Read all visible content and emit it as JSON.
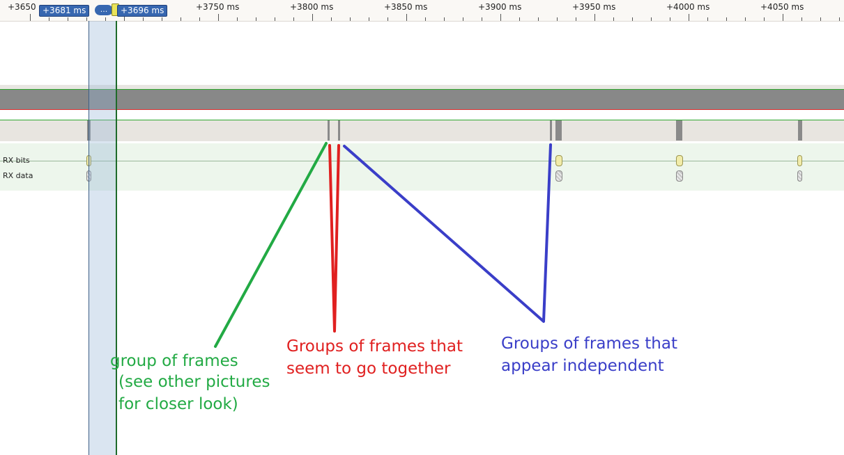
{
  "timeline": {
    "ticks": [
      "+3650",
      "+3750 ms",
      "+3800 ms",
      "+3850 ms",
      "+3900 ms",
      "+3950 ms",
      "+4000 ms",
      "+4050 ms"
    ],
    "markers": {
      "start": "+3681 ms",
      "middle": "...",
      "end": "+3696 ms"
    }
  },
  "rows": {
    "bits": "RX bits",
    "data": "RX data"
  },
  "annotations": {
    "green": [
      "group of frames",
      "(see other pictures",
      "for closer look)"
    ],
    "red": [
      "Groups of frames that",
      "seem to go together"
    ],
    "blue": [
      "Groups of frames that",
      "appear independent"
    ]
  },
  "colors": {
    "green": "#22aa44",
    "red": "#e02020",
    "blue": "#3a3ec8",
    "marker": "#3767b0",
    "handle": "#e9e35a"
  },
  "icons": {
    "handle": "time-cursor-handle-icon"
  }
}
